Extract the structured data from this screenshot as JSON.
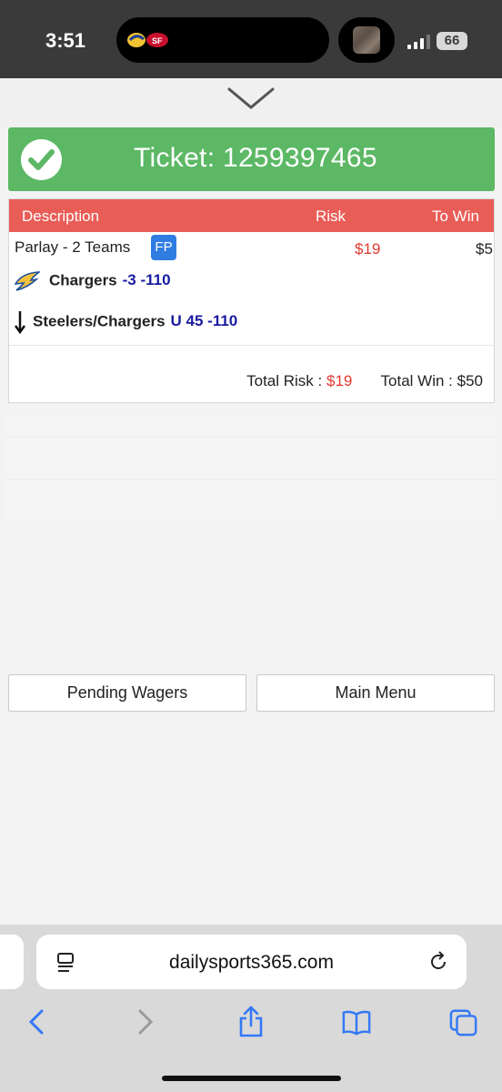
{
  "status_bar": {
    "time": "3:51",
    "battery": "66",
    "icons": [
      "rams-logo",
      "49ers-logo",
      "signal-icon"
    ]
  },
  "ticket": {
    "label": "Ticket: 1259397465"
  },
  "wager_table": {
    "headers": {
      "description": "Description",
      "risk": "Risk",
      "to_win": "To Win"
    },
    "parlay": {
      "label": "Parlay - 2 Teams",
      "badge": "FP",
      "risk": "$19",
      "to_win": "$5"
    },
    "legs": [
      {
        "team": "Chargers",
        "line": "-3 -110",
        "icon": "chargers-bolt-icon"
      },
      {
        "team": "Steelers/Chargers",
        "line": "U 45 -110",
        "icon": "down-arrow-icon"
      }
    ],
    "totals": {
      "risk_label": "Total Risk :",
      "risk_value": "$19",
      "win_label": "Total Win :",
      "win_value": "$50"
    }
  },
  "buttons": {
    "pending": "Pending Wagers",
    "main_menu": "Main Menu"
  },
  "browser": {
    "url": "dailysports365.com"
  },
  "colors": {
    "banner_green": "#5cb865",
    "header_red": "#e95d57",
    "risk_red": "#e0382f",
    "line_blue": "#1a1aa0",
    "badge_blue": "#2f7de1",
    "ios_blue": "#3478f6"
  }
}
